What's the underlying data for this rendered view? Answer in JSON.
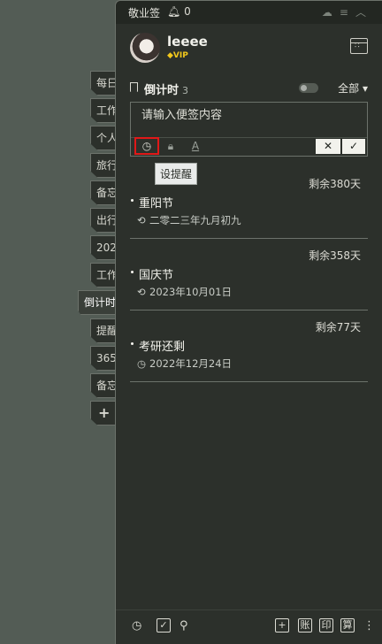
{
  "side_tabs": [
    "每日",
    "工作",
    "个人",
    "旅行",
    "备忘",
    "出行",
    "202",
    "工作",
    "倒计时",
    "提醒",
    "365",
    "备忘",
    "+"
  ],
  "titlebar": {
    "app_name": "敬业签",
    "notifications": "0"
  },
  "user": {
    "name": "leeee",
    "badge": "VIP"
  },
  "category": {
    "name": "倒计时",
    "count": "3",
    "filter": "全部 ▾"
  },
  "editor": {
    "placeholder": "请输入便签内容",
    "value": "",
    "tooltip": "设提醒"
  },
  "notes": [
    {
      "remaining": "剩余380天",
      "title": "重阳节",
      "date": "二零二三年九月初九",
      "date_icon": "repeat-icon"
    },
    {
      "remaining": "剩余358天",
      "title": "国庆节",
      "date": "2023年10月01日",
      "date_icon": "repeat-icon"
    },
    {
      "remaining": "剩余77天",
      "title": "考研还剩",
      "date": "2022年12月24日",
      "date_icon": "clock-icon"
    }
  ],
  "bottombar": {
    "btn1": "账",
    "btn2": "印",
    "btn3": "算"
  },
  "colors": {
    "panel": "#2c302b",
    "background": "#535c55",
    "vip": "#f2c81c",
    "highlight": "#e01818"
  }
}
